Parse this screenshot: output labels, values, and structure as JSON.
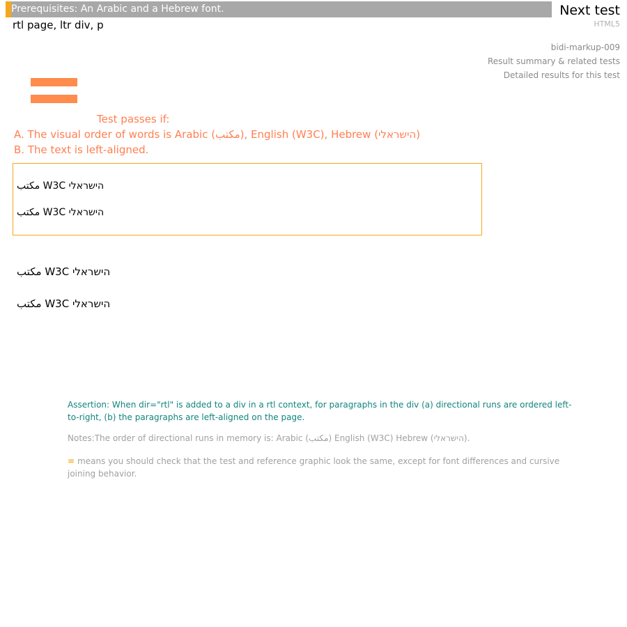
{
  "header": {
    "prerequisites": "Prerequisites: An Arabic and a Hebrew font.",
    "page_title": "rtl page, ltr div, p",
    "next_test": "Next test",
    "spec": "HTML5"
  },
  "side_links": {
    "test_id": "bidi-markup-009",
    "summary": "Result summary & related tests",
    "detailed": "Detailed results for this test"
  },
  "instructions": {
    "heading": "Test passes if:",
    "item_a": "A. The visual order of words is Arabic (مكتب), English (W3C), Hebrew (הישראלי)",
    "item_b": "B. The text is left-aligned."
  },
  "test_box": {
    "line1": "مكتب W3C הישראלי",
    "line2": "مكتب W3C הישראלי"
  },
  "reference": {
    "line1": "مكتب W3C הישראלי",
    "line2": "مكتب W3C הישראלי"
  },
  "footer": {
    "assertion": "Assertion: When dir=\"rtl\" is added to a div in a rtl context, for paragraphs in the div (a) directional runs are ordered left-to-right, (b) the paragraphs are left-aligned on the page.",
    "notes": "Notes:The order of directional runs in memory is: Arabic (مكتب) English (W3C) Hebrew (הישראלי).",
    "equals_symbol": "=",
    "equals_note": "means you should check that the test and reference graphic look the same, except for font differences and cursive joining behavior."
  },
  "colors": {
    "accent_orange": "#f7a71b",
    "instruction_text": "#ff7f50",
    "assertion_teal": "#11857c"
  }
}
